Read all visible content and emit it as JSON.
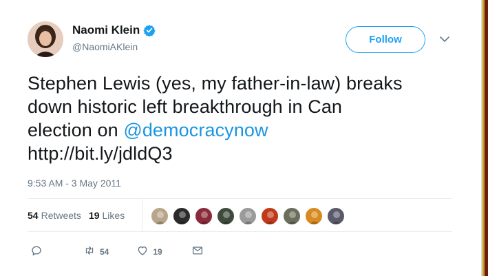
{
  "user": {
    "display_name": "Naomi Klein",
    "handle": "@NaomiAKlein"
  },
  "follow_label": "Follow",
  "tweet": {
    "line1": "Stephen Lewis (yes, my father-in-law) breaks",
    "line2": "down historic left breakthrough in Can",
    "line3_prefix": "election on ",
    "mention": "@democracynow",
    "line4": "http://bit.ly/jdldQ3"
  },
  "timestamp": "9:53 AM - 3 May 2011",
  "stats": {
    "retweets_count": "54",
    "retweets_label": "Retweets",
    "likes_count": "19",
    "likes_label": "Likes"
  },
  "actions": {
    "retweet_count": "54",
    "like_count": "19"
  },
  "likers": [
    {
      "icon": "liker-avatar-1",
      "color": "#b9a68a"
    },
    {
      "icon": "liker-avatar-2",
      "color": "#2b2b2b"
    },
    {
      "icon": "liker-avatar-3",
      "color": "#8a2a3a"
    },
    {
      "icon": "liker-avatar-4",
      "color": "#3e4a3a"
    },
    {
      "icon": "liker-avatar-5",
      "color": "#9a9a9a"
    },
    {
      "icon": "liker-avatar-6",
      "color": "#c03a1a"
    },
    {
      "icon": "liker-avatar-7",
      "color": "#6a6e5a"
    },
    {
      "icon": "liker-avatar-8",
      "color": "#d88a20"
    },
    {
      "icon": "liker-avatar-9",
      "color": "#5a5a6a"
    }
  ],
  "colors": {
    "accent": "#1da1f2",
    "link": "#1b95e0",
    "muted": "#657786",
    "text": "#14171a"
  }
}
